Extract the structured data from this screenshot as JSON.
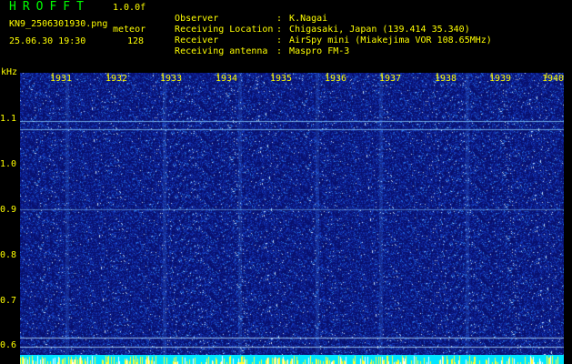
{
  "header": {
    "app_title": "HROFFT",
    "version": "1.0.0f",
    "filename": "KN9_2506301930.png",
    "mode": "meteor",
    "datetime": "25.06.30 19:30",
    "count": "128"
  },
  "meta": [
    {
      "key": "Observer",
      "value": "K.Nagai"
    },
    {
      "key": "Receiving Location",
      "value": "Chigasaki, Japan (139.414 35.340)"
    },
    {
      "key": "Receiver",
      "value": "AirSpy mini (Miakejima VOR 108.65MHz)"
    },
    {
      "key": "Receiving antenna",
      "value": "Maspro FM-3"
    }
  ],
  "y_axis": {
    "unit": "kHz",
    "ticks": [
      "1.1",
      "1.0",
      "0.9",
      "0.8",
      "0.7",
      "0.6"
    ]
  },
  "x_axis": {
    "ticks": [
      "1931",
      "1932",
      "1933",
      "1934",
      "1935",
      "1936",
      "1937",
      "1938",
      "1939",
      "1940"
    ]
  },
  "colors": {
    "background": "#000000",
    "text": "#ffff00",
    "title": "#00ff00",
    "noise_base": "#0a1a8c",
    "bottom_strip": "#00e5ff"
  }
}
